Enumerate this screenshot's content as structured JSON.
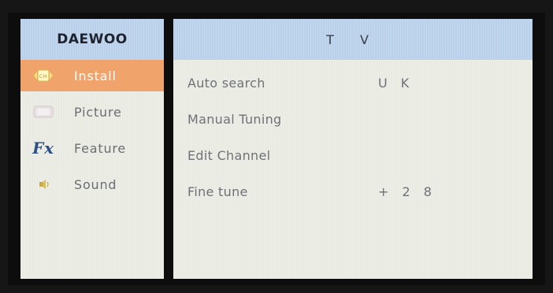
{
  "brand": "DAEWOO",
  "header": {
    "title": "T V"
  },
  "sidebar": {
    "items": [
      {
        "label": "Install",
        "icon": "ch-icon",
        "active": true
      },
      {
        "label": "Picture",
        "icon": "picture-icon",
        "active": false
      },
      {
        "label": "Feature",
        "icon": "fx-icon",
        "icon_text": "Fx",
        "active": false
      },
      {
        "label": "Sound",
        "icon": "speaker-icon",
        "active": false
      }
    ]
  },
  "main": {
    "rows": [
      {
        "label": "Auto search",
        "value": "U K"
      },
      {
        "label": "Manual Tuning",
        "value": ""
      },
      {
        "label": "Edit Channel",
        "value": ""
      },
      {
        "label": "Fine tune",
        "value": "+ 2 8"
      }
    ]
  },
  "colors": {
    "header_blue": "#b9d0ea",
    "active_orange": "#f0a36a",
    "panel_bg": "#eceee6",
    "text_gray": "#6c6e74"
  }
}
